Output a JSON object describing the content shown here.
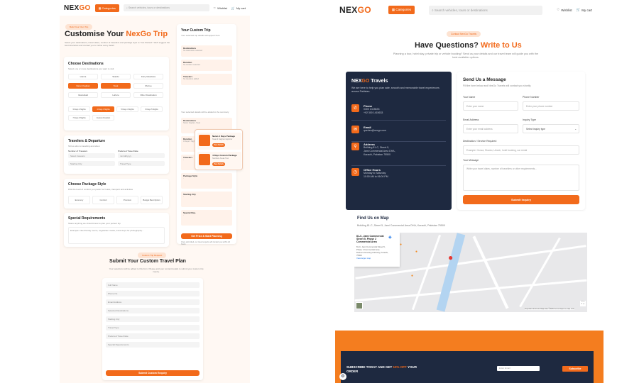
{
  "left": {
    "header": {
      "logo_main": "NEX",
      "logo_accent": "GO",
      "categories_label": "Categories",
      "search_placeholder": "Search vehicles, tours or destinations",
      "wishlist_label": "Wishlist",
      "cart_label": "My cart",
      "wishlist_count": "0",
      "cart_count": "0"
    },
    "badge": "Build Your Own Trip",
    "title_pre": "Customise Your ",
    "title_accent": "NexGo Trip",
    "intro": "Select your destinations, travel dates, number of travellers and package style to \"Get Started\". We'll suggest the best itineraries and contact you to refine every detail.",
    "destinations": {
      "title": "Choose Destinations",
      "hint": "Select one or more destinations you want to visit",
      "chips": [
        {
          "label": "Hunza",
          "on": false
        },
        {
          "label": "Skardu",
          "on": false
        },
        {
          "label": "Fairy Meadows",
          "on": false
        },
        {
          "label": "Naran Kaghan",
          "on": true
        },
        {
          "label": "Swat",
          "on": true
        },
        {
          "label": "Murree",
          "on": false
        },
        {
          "label": "Islamabad",
          "on": false
        },
        {
          "label": "Lahore",
          "on": false
        },
        {
          "label": "Other Destination",
          "on": false
        }
      ],
      "durations": [
        {
          "label": "3 Days 2 Nights",
          "on": false
        },
        {
          "label": "4 Days 3 Nights",
          "on": true
        },
        {
          "label": "5 Days 4 Nights",
          "on": false
        },
        {
          "label": "6 Days 5 Nights",
          "on": false
        },
        {
          "label": "7 Days 6 Nights",
          "on": false
        },
        {
          "label": "Custom Duration",
          "on": false
        }
      ]
    },
    "travelers": {
      "title": "Travelers & Departure",
      "hint": "Tell us who is travelling and when",
      "f1_label": "Number of Travelers",
      "f1_value": "Select travelers",
      "f2_label": "Preferred Travel Date",
      "f2_value": "mm/dd/yyyy",
      "f3_label": "Starting City",
      "f4_label": "Travel Type"
    },
    "package": {
      "title": "Choose Package Style",
      "hint": "Pick the level of comfort you prefer for hotels, transport and activities",
      "options": [
        "Economy",
        "Comfort",
        "Premium",
        "Budget Best Option"
      ]
    },
    "special": {
      "title": "Special Requirements",
      "hint": "Share anything we should know to plan your perfect trip",
      "placeholder": "Example: Need family rooms, vegetarian meals, extra stops for photography..."
    },
    "summary": {
      "title": "Your Custom Trip",
      "hint": "Your selected trip details will appear here",
      "rows": [
        {
          "k": "Destinations",
          "v": "No destination selected"
        },
        {
          "k": "Duration",
          "v": "No duration selected"
        },
        {
          "k": "Travelers",
          "v": "No travelers added"
        }
      ],
      "note": "Your selected details will be added to the summary",
      "rows2": [
        {
          "k": "Destinations",
          "v": "Naran Kaghan, Swat"
        },
        {
          "k": "Duration",
          "v": "4 Days 3 Nights"
        },
        {
          "k": "Travelers",
          "v": "-"
        },
        {
          "k": "Package Style",
          "v": "-"
        },
        {
          "k": "Starting City",
          "v": "-"
        },
        {
          "k": "Special Req.",
          "v": "-"
        }
      ],
      "button": "Get Price & Start Planning",
      "footnote": "Once submitted, our travel experts will contact you within 24 hours"
    },
    "popup": {
      "items": [
        {
          "title": "Naran 4 Days Package",
          "sub": "Swat & Kaghan Explorer",
          "btn": "View Details"
        },
        {
          "title": "4 Days Custom Package",
          "sub": "Northern Areas Tour",
          "btn": "View Details"
        }
      ]
    },
    "submit": {
      "badge": "Custom Trip Request",
      "title": "Submit Your Custom Travel Plan",
      "desc": "Your selections will be added to this form. Please add your contact details to submit your custom trip inquiry.",
      "fields": [
        "Full Name",
        "Phone No",
        "Email Address",
        "Selected Destinations",
        "Starting City",
        "Travel Type",
        "Preferred Travel Date",
        "Special Requirements"
      ],
      "button": "Submit Custom Enquiry"
    }
  },
  "right": {
    "header": {
      "logo_main": "NEX",
      "logo_accent": "GO",
      "categories_label": "Categories",
      "search_placeholder": "Search vehicles, tours or destinations",
      "wishlist_label": "Wishlist",
      "cart_label": "My cart",
      "wishlist_count": "0",
      "cart_count": "0"
    },
    "badge": "Contact NexGo Travels",
    "title_pre": "Have Questions? ",
    "title_accent": "Write to Us",
    "subtitle": "Planning a tour, hotel stay, private trip or vehicle booking? Send us your details and our travel team will guide you with the best available options.",
    "info": {
      "brand_main": "NEX",
      "brand_accent": "GO",
      "brand_suffix": " Travels",
      "desc": "We are here to help you plan safe, smooth and memorable travel experiences across Pakistan.",
      "items": [
        {
          "icon": "phone-icon",
          "glyph": "✆",
          "title": "Phone",
          "lines": [
            "0300 1415633",
            "+92 300 1415633"
          ]
        },
        {
          "icon": "email-icon",
          "glyph": "✉",
          "title": "Email",
          "lines": [
            "queries@nexgo.com"
          ]
        },
        {
          "icon": "location-icon",
          "glyph": "⚲",
          "title": "Address",
          "lines": [
            "Building 81-C, Street 5,",
            "Jami Commercial Area DHA,",
            "Karachi, Pakistan 75500"
          ]
        },
        {
          "icon": "clock-icon",
          "glyph": "◷",
          "title": "Office Hours",
          "lines": [
            "Monday to Saturday",
            "10:00 AM to 06:00 PM"
          ]
        }
      ]
    },
    "form": {
      "title": "Send Us a Message",
      "desc": "Fill the form below and NexGo Travels will contact you shortly.",
      "name_label": "Your Name",
      "name_ph": "Enter your name",
      "phone_label": "Phone Number",
      "phone_ph": "Enter your phone number",
      "email_label": "Email Address",
      "email_ph": "Enter your email address",
      "type_label": "Inquiry Type",
      "type_value": "Select inquiry type",
      "dest_label": "Destination / Service Required",
      "dest_ph": "Example: Hunza, Skardu, Umrah, hotel booking, car rental",
      "msg_label": "Your Message",
      "msg_ph": "Write your travel dates, number of travellers or other requirements...",
      "submit": "Submit Inquiry"
    },
    "map": {
      "title": "Find Us on Map",
      "address": "Building 81-C, Street 5, Jami Commercial Area DHA, Karachi, Pakistan 75500",
      "card_title": "81-C, Jami Commercial Street 5, Phase 2 Commercial Area",
      "card_lines": [
        "81-C, Jami Commercial Street 5, Phase 2 Commercial Area",
        "Defence Housing Authority, Karachi, 75500",
        "View larger map"
      ],
      "footer": "Keyboard shortcuts   Map data ©2025   Terms   Report a map error"
    },
    "newsletter": {
      "text_pre": "SUBSCRIBE TODAY AND GET ",
      "text_accent": "10% OFF",
      "text_post": " YOUR ORDER",
      "placeholder": "Enter Email",
      "button": "Subscribe"
    }
  }
}
